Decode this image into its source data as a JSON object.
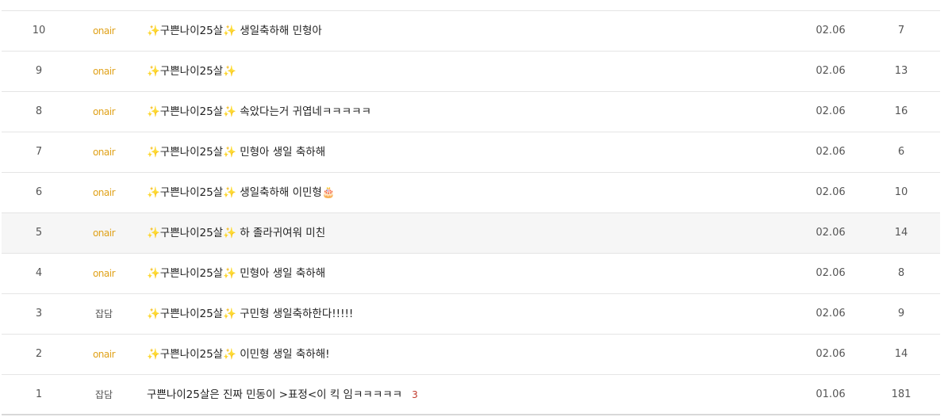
{
  "rows": [
    {
      "num": "10",
      "category": "onair",
      "title": "✨구쁜나이25살✨ 생일축하해 민형아",
      "comments": "",
      "date": "02.06",
      "views": "7"
    },
    {
      "num": "9",
      "category": "onair",
      "title": "✨구쁜나이25살✨",
      "comments": "",
      "date": "02.06",
      "views": "13"
    },
    {
      "num": "8",
      "category": "onair",
      "title": "✨구쁜나이25살✨ 속았다는거 귀엽네ㅋㅋㅋㅋㅋ",
      "comments": "",
      "date": "02.06",
      "views": "16"
    },
    {
      "num": "7",
      "category": "onair",
      "title": "✨구쁜나이25살✨ 민형아 생일 축하해",
      "comments": "",
      "date": "02.06",
      "views": "6"
    },
    {
      "num": "6",
      "category": "onair",
      "title": "✨구쁜나이25살✨ 생일축하해 이민형🎂",
      "comments": "",
      "date": "02.06",
      "views": "10"
    },
    {
      "num": "5",
      "category": "onair",
      "title": "✨구쁜나이25살✨ 하 졸라귀여워 미친",
      "comments": "",
      "date": "02.06",
      "views": "14"
    },
    {
      "num": "4",
      "category": "onair",
      "title": "✨구쁜나이25살✨ 민형아 생일 축하해",
      "comments": "",
      "date": "02.06",
      "views": "8"
    },
    {
      "num": "3",
      "category": "잡담",
      "title": "✨구쁜나이25살✨ 구민형 생일축하한다!!!!!",
      "comments": "",
      "date": "02.06",
      "views": "9"
    },
    {
      "num": "2",
      "category": "onair",
      "title": "✨구쁜나이25살✨ 이민형 생일 축하해!",
      "comments": "",
      "date": "02.06",
      "views": "14"
    },
    {
      "num": "1",
      "category": "잡담",
      "title": "구쁜나이25살은 진짜 민동이 >표정<이 킥 임ㅋㅋㅋㅋㅋ",
      "comments": "3",
      "date": "01.06",
      "views": "181"
    }
  ],
  "highlighted_row": "5",
  "colors": {
    "onair": "#e0a21a",
    "comment_count": "#c0392b",
    "row_highlight": "#f6f6f6"
  }
}
